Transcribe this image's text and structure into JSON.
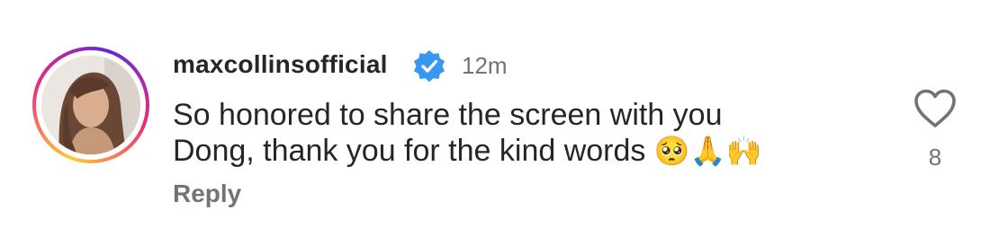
{
  "comment": {
    "username": "maxcollinsofficial",
    "verified_icon": "verified-badge-icon",
    "timestamp": "12m",
    "text_line1": "So honored to share the screen with you",
    "text_line2": "Dong, thank you for the kind words",
    "emojis": "🥺🙏🙌",
    "reply_label": "Reply",
    "like_icon": "heart-icon",
    "like_count": "8"
  },
  "colors": {
    "text": "#262626",
    "secondary": "#737373",
    "verified_blue": "#3897f0"
  }
}
